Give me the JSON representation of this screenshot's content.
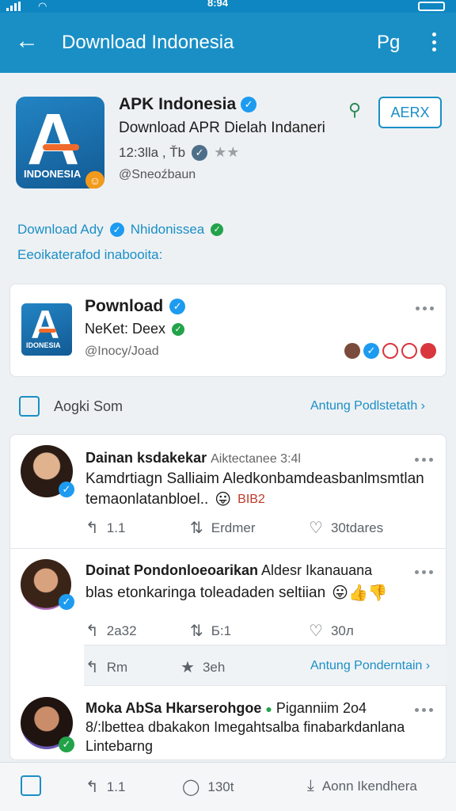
{
  "status": {
    "time": "8:94"
  },
  "appbar": {
    "title": "Download Indonesia",
    "right_label": "Pg"
  },
  "app": {
    "icon_letter": "A",
    "icon_label": "INDONESIA",
    "name": "APK Indonesia",
    "subtitle": "Download APR Dielah Indaneri",
    "meta": "12:3lla , Ťb",
    "handle": "@Sneoźbaun",
    "action_button": "AERX"
  },
  "links": {
    "line1_a": "Download Ady",
    "line1_b": "Nhidonissea",
    "line2": "Eeoikaterafod inabooita:"
  },
  "featured": {
    "icon_letter": "A",
    "icon_label": "IDONESIA",
    "title": "Pownload",
    "subtitle": "NeKet: Deex",
    "handle": "@Inocy/Joad"
  },
  "section1": {
    "label": "Aogki Som",
    "link": "Antung Podlstetath"
  },
  "posts": [
    {
      "name": "Dainan ksdakekar",
      "time": "Aiktectanee 3:4l",
      "text1": "Kamdrtiagn Salliaim Aledkonbamdeasbanlmsmtlan",
      "text2": "temaonlatanbloel..",
      "text2_tail": "BIB2",
      "reply": "1.1",
      "share": "Erdmer",
      "likes": "30tdares"
    },
    {
      "name": "Doinat Pondonloeoarikan",
      "time": "Aldesr Ikanauana",
      "text1": "blas etonkaringa toleadaden seltiian",
      "reply": "2a32",
      "share": "Б:1",
      "likes": "30л"
    },
    {
      "name": "Moka AbSa Hkarserohgoe",
      "time": "Piganniim 2o4",
      "text1": "8/:lbettea dbakakon Imegahtsalba finabarkdanlana",
      "text2": "Lintebarng"
    }
  ],
  "subbar": {
    "reply": "Rm",
    "share": "3eh",
    "link": "Antung Ponderntain"
  },
  "bottom": {
    "reply": "1.1",
    "comments": "130t",
    "link": "Aonn Ikendhera"
  }
}
